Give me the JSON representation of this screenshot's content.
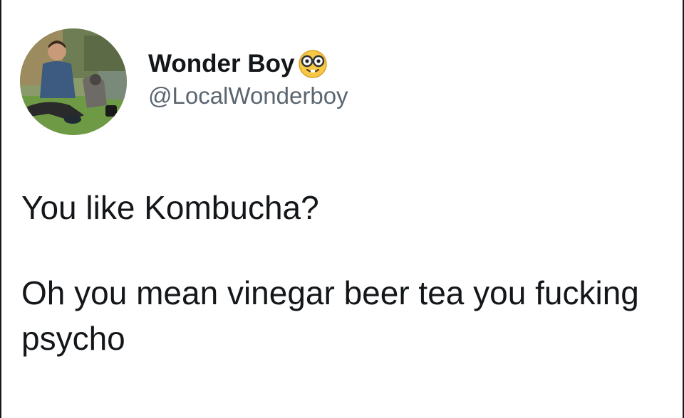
{
  "tweet": {
    "author": {
      "display_name": "Wonder Boy",
      "badge_icon": "nerd-face-emoji",
      "handle": "@LocalWonderboy",
      "avatar": "profile-photo"
    },
    "text_lines": [
      "You like Kombucha?",
      "Oh you mean vinegar beer tea you fucking psycho"
    ]
  },
  "colors": {
    "name": "#14171a",
    "handle": "#5b6670",
    "background": "#ffffff",
    "emoji_fill": "#f7c843"
  }
}
